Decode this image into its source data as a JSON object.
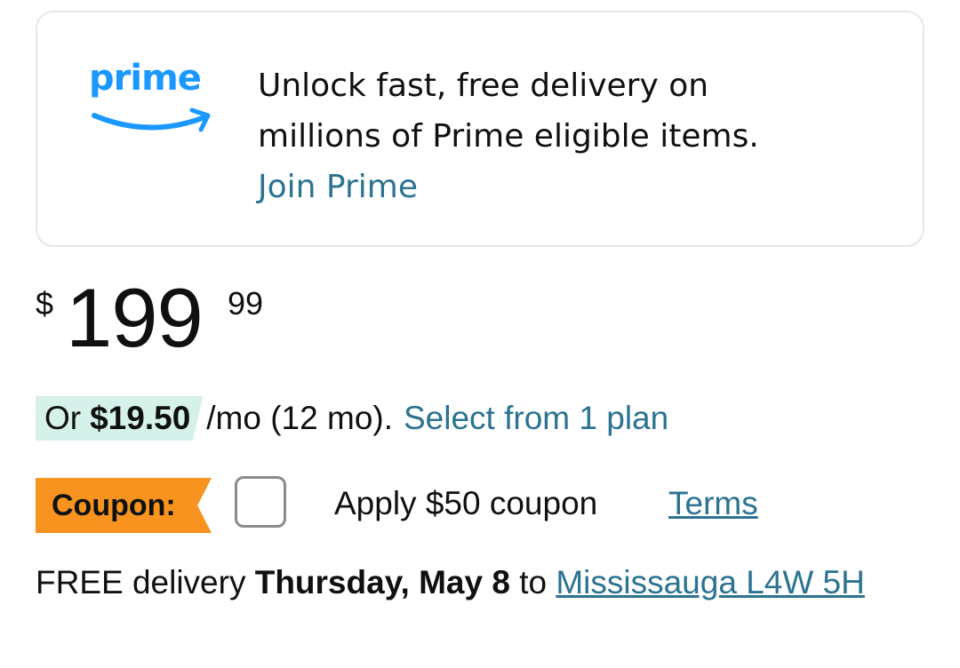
{
  "prime_banner": {
    "logo_text": "prime",
    "line1": "Unlock fast, free delivery on",
    "line2": "millions of Prime eligible items.",
    "join_link": "Join Prime",
    "logo_color": "#1a98ff",
    "link_color": "#2b7391"
  },
  "price": {
    "symbol": "$",
    "whole": "199",
    "fraction": "99"
  },
  "monthly_payment": {
    "or_word": "Or",
    "amount": "$19.50",
    "term": "/mo (12 mo).",
    "plan_link": "Select from 1 plan",
    "highlight_color": "#d6f0ea"
  },
  "coupon": {
    "badge_label": "Coupon:",
    "checked": false,
    "apply_text": "Apply $50 coupon",
    "terms_link": "Terms",
    "badge_color": "#f7931e"
  },
  "delivery": {
    "prefix": "FREE delivery",
    "date": "Thursday, May 8",
    "to_word": "to",
    "location_link": "Mississauga L4W 5H"
  }
}
